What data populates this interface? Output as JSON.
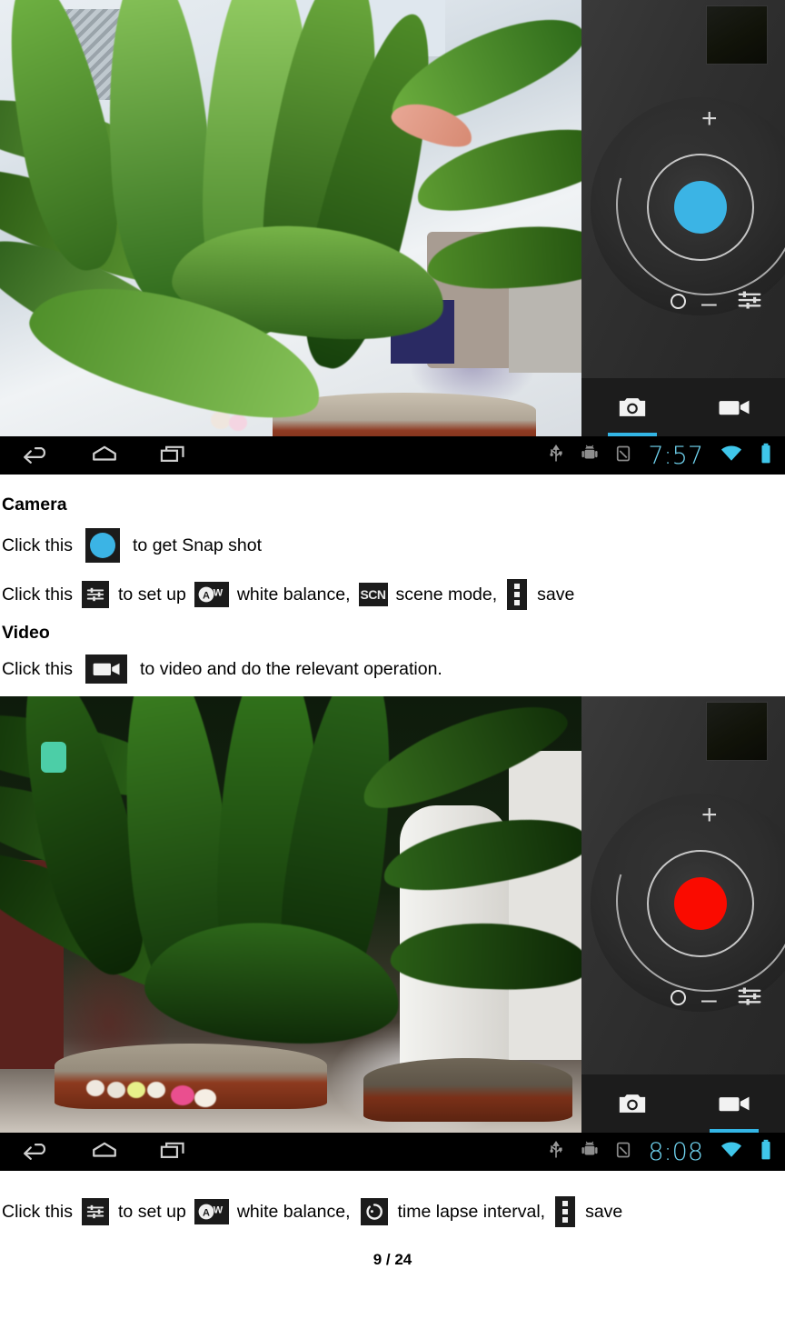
{
  "document": {
    "page_number": "9 / 24"
  },
  "screenshot_camera": {
    "name": "camera-mode-screenshot",
    "status_bar": {
      "time": "7:57",
      "icons": [
        "usb-icon",
        "android-debug-icon",
        "sd-card-icon",
        "wifi-icon",
        "battery-icon"
      ]
    },
    "nav_bar": {
      "back": "back-icon",
      "home": "home-icon",
      "recents": "recent-apps-icon"
    },
    "panel": {
      "thumbnail": "last-capture-thumbnail",
      "zoom_in": "+",
      "zoom_out": "–",
      "shutter": "shutter-button",
      "shutter_color": "#3bb4e5",
      "settings": "settings-sliders-icon",
      "tabs": [
        {
          "label": "camera-tab",
          "active": true
        },
        {
          "label": "video-tab",
          "active": false
        }
      ]
    }
  },
  "screenshot_video": {
    "name": "video-mode-screenshot",
    "status_bar": {
      "time": "8:08",
      "icons": [
        "usb-icon",
        "android-debug-icon",
        "sd-card-icon",
        "wifi-icon",
        "battery-icon"
      ]
    },
    "nav_bar": {
      "back": "back-icon",
      "home": "home-icon",
      "recents": "recent-apps-icon"
    },
    "panel": {
      "thumbnail": "last-capture-thumbnail",
      "zoom_in": "+",
      "zoom_out": "–",
      "shutter": "record-button",
      "shutter_color": "#fa0b00",
      "settings": "settings-sliders-icon",
      "tabs": [
        {
          "label": "camera-tab",
          "active": false
        },
        {
          "label": "video-tab",
          "active": true
        }
      ]
    }
  },
  "content": {
    "camera_heading": "Camera",
    "video_heading": "Video",
    "snap_line": {
      "prefix": "Click this",
      "suffix": "to get Snap shot"
    },
    "camera_setup_line": {
      "prefix": "Click this",
      "mid1": "to set up",
      "mid2": "white balance,",
      "scn_label": "SCN",
      "mid3": "scene mode,",
      "suffix": "save"
    },
    "video_line": {
      "prefix": "Click this",
      "suffix": "to video and do the relevant operation."
    },
    "video_setup_line": {
      "prefix": "Click this",
      "mid1": "to set up",
      "mid2": "white balance,",
      "mid3": "time lapse interval,",
      "suffix": "save"
    }
  },
  "colors": {
    "accent_blue": "#33b5e5",
    "shutter_blue": "#3bb4e5",
    "record_red": "#fa0b00",
    "status_text": "#6fd3ef"
  }
}
